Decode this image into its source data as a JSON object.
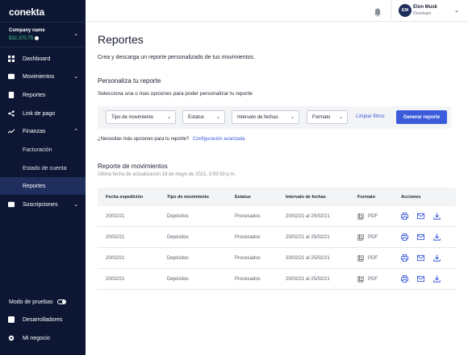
{
  "app": {
    "logo": "conekta"
  },
  "company": {
    "name": "Company name",
    "amount": "$32,370.75"
  },
  "sidebar": {
    "items": [
      {
        "label": "Dashboard",
        "icon": "dashboard-icon"
      },
      {
        "label": "Movimientos",
        "icon": "wallet-icon"
      },
      {
        "label": "Reportes",
        "icon": "document-icon"
      },
      {
        "label": "Link de pago",
        "icon": "share-icon"
      },
      {
        "label": "Finanzas",
        "icon": "trend-icon"
      }
    ],
    "finanzas_sub": [
      {
        "label": "Facturación"
      },
      {
        "label": "Estado de cuenta"
      },
      {
        "label": "Reportes",
        "active": true
      }
    ],
    "suscripciones": {
      "label": "Suscripciones",
      "icon": "card-icon"
    },
    "test_mode": {
      "label": "Modo de pruebas"
    },
    "developers": {
      "label": "Desarrolladores",
      "icon": "code-icon"
    },
    "my_business": {
      "label": "Mi negocio",
      "icon": "gear-icon"
    }
  },
  "user": {
    "initials": "EM",
    "name": "Elon Musk",
    "role": "Developer"
  },
  "main": {
    "title": "Reportes",
    "subtitle": "Crea y descarga un reporte personalizado de tus movimientos.",
    "customize_title": "Personaliza tu reporte",
    "customize_sub": "Selecciona una o mas opciones para poder personalizar tu reporte",
    "filters": {
      "tipo": "Tipo de movimiento",
      "estatus": "Estatus",
      "intervalo": "Intervalo de fechas",
      "formato": "Formato",
      "clear": "Limpiar filtros",
      "generate": "Generar reporte"
    },
    "more_options": "¿Necesitas más opciones para tu reporte?",
    "advanced": "Configuración avanzada",
    "report_title": "Reporte de movimientos",
    "updated": "Última fecha de actualización 19 de mayo de 2021, 3:59:59 p.m.",
    "table": {
      "headers": [
        "Fecha expedición",
        "Tipo de movimiento",
        "Estatus",
        "Intervalo de fechas",
        "Formato",
        "Acciones"
      ],
      "rows": [
        {
          "fecha": "20/02/21",
          "tipo": "Depósitos",
          "estatus": "Procesados",
          "intervalo": "20/02/21 al 25/02/21",
          "formato": "PDF"
        },
        {
          "fecha": "20/02/21",
          "tipo": "Depósitos",
          "estatus": "Procesados",
          "intervalo": "20/02/21 al 25/02/21",
          "formato": "PDF"
        },
        {
          "fecha": "20/02/21",
          "tipo": "Depósitos",
          "estatus": "Procesados",
          "intervalo": "20/02/21 al 25/02/21",
          "formato": "PDF"
        },
        {
          "fecha": "20/02/21",
          "tipo": "Depósitos",
          "estatus": "Procesados",
          "intervalo": "20/02/21 al 25/02/21",
          "formato": "PDF"
        }
      ]
    }
  },
  "colors": {
    "sidebar_bg": "#0d1733",
    "accent": "#3b5bdb",
    "amount": "#3fcf8e",
    "active_item": "#1f2e5c"
  }
}
